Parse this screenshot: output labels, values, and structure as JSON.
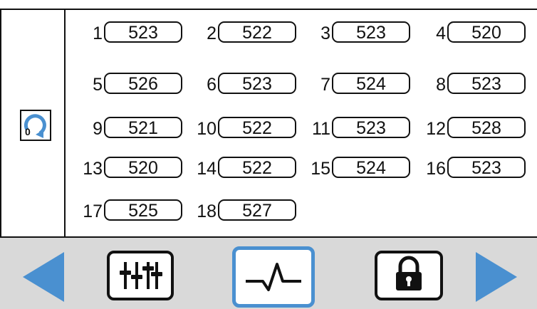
{
  "sidebar": {
    "reset_digit": "0",
    "reset_icon": "refresh-counter-icon"
  },
  "channels": [
    {
      "id": "1",
      "value": "523"
    },
    {
      "id": "2",
      "value": "522"
    },
    {
      "id": "3",
      "value": "523"
    },
    {
      "id": "4",
      "value": "520"
    },
    {
      "id": "5",
      "value": "526"
    },
    {
      "id": "6",
      "value": "523"
    },
    {
      "id": "7",
      "value": "524"
    },
    {
      "id": "8",
      "value": "523"
    },
    {
      "id": "9",
      "value": "521"
    },
    {
      "id": "10",
      "value": "522"
    },
    {
      "id": "11",
      "value": "523"
    },
    {
      "id": "12",
      "value": "528"
    },
    {
      "id": "13",
      "value": "520"
    },
    {
      "id": "14",
      "value": "522"
    },
    {
      "id": "15",
      "value": "524"
    },
    {
      "id": "16",
      "value": "523"
    },
    {
      "id": "17",
      "value": "525"
    },
    {
      "id": "18",
      "value": "527"
    }
  ],
  "toolbar": {
    "prev_icon": "triangle-left-icon",
    "mixer_icon": "sliders-icon",
    "pulse_icon": "heartbeat-waveform-icon",
    "lock_icon": "padlock-icon",
    "next_icon": "triangle-right-icon",
    "accent": "#4a90d0",
    "active_border": "#4a90d0"
  }
}
